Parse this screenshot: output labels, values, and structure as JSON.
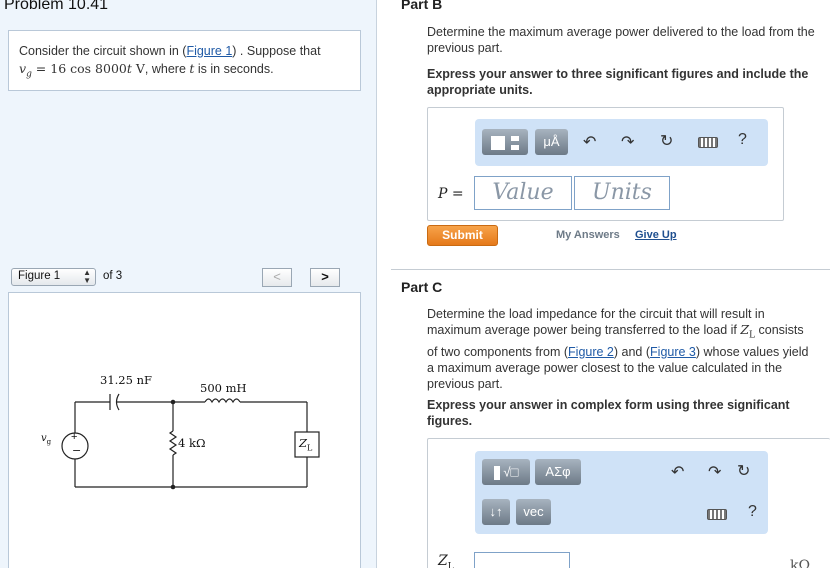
{
  "problem": {
    "title": "Problem 10.41",
    "text_before_link": "Consider the circuit shown in (",
    "figure_link": "Figure 1",
    "text_after_link": ") . Suppose that",
    "eq_vg": "v",
    "eq_sub": "g",
    "eq_rest": " = 16 cos 8000",
    "eq_t": "t",
    "eq_unit": " V",
    "eq_tail": ", where ",
    "eq_t2": "t",
    "eq_tail2": " is in seconds."
  },
  "figure_nav": {
    "selected": "Figure 1",
    "of_label": "of 3",
    "prev": "<",
    "next": ">"
  },
  "circuit": {
    "capacitor": "31.25 nF",
    "inductor": "500 mH",
    "resistor": "4 kΩ",
    "load_symbol": "Z",
    "load_sub": "L",
    "source_symbol": "v",
    "source_sub": "g",
    "plus": "+",
    "minus": "−"
  },
  "part_b": {
    "title": "Part B",
    "question_l1": "Determine the maximum average power delivered to the load from the",
    "question_l2": "previous part.",
    "instruction_l1": "Express your answer to three significant figures and include the",
    "instruction_l2": "appropriate units.",
    "toolbar": {
      "units_btn": "μÅ",
      "help": "?"
    },
    "variable_label": "P =",
    "value_placeholder": "Value",
    "units_placeholder": "Units",
    "submit": "Submit",
    "my_answers": "My Answers",
    "give_up": "Give Up"
  },
  "part_c": {
    "title": "Part C",
    "q_l1": "Determine the load impedance for the circuit that will result in",
    "q_l2_a": "maximum average power being transferred to the load if ",
    "q_l2_z": "Z",
    "q_l2_sub": "L",
    "q_l2_b": " consists",
    "q_l3_a": "of two components from (",
    "q_l3_fig2": "Figure 2",
    "q_l3_mid": ") and (",
    "q_l3_fig3": "Figure 3",
    "q_l3_b": ") whose values yield",
    "q_l4": "a maximum average power closest to the value calculated in the",
    "q_l5": "previous part.",
    "instruction_l1": "Express your answer in complex form using three significant",
    "instruction_l2": "figures.",
    "toolbar": {
      "greek_btn": "ΑΣφ",
      "sort_btn": "↓↑",
      "vec_btn": "vec",
      "help": "?"
    },
    "variable_z": "Z",
    "variable_sub": "L",
    "unit_partial": "kΩ"
  },
  "colors": {
    "left_bg": "#eef5fc",
    "toolbar_bg": "#cfe2f7",
    "submit": "#e5791a",
    "link": "#1f5aa6"
  }
}
